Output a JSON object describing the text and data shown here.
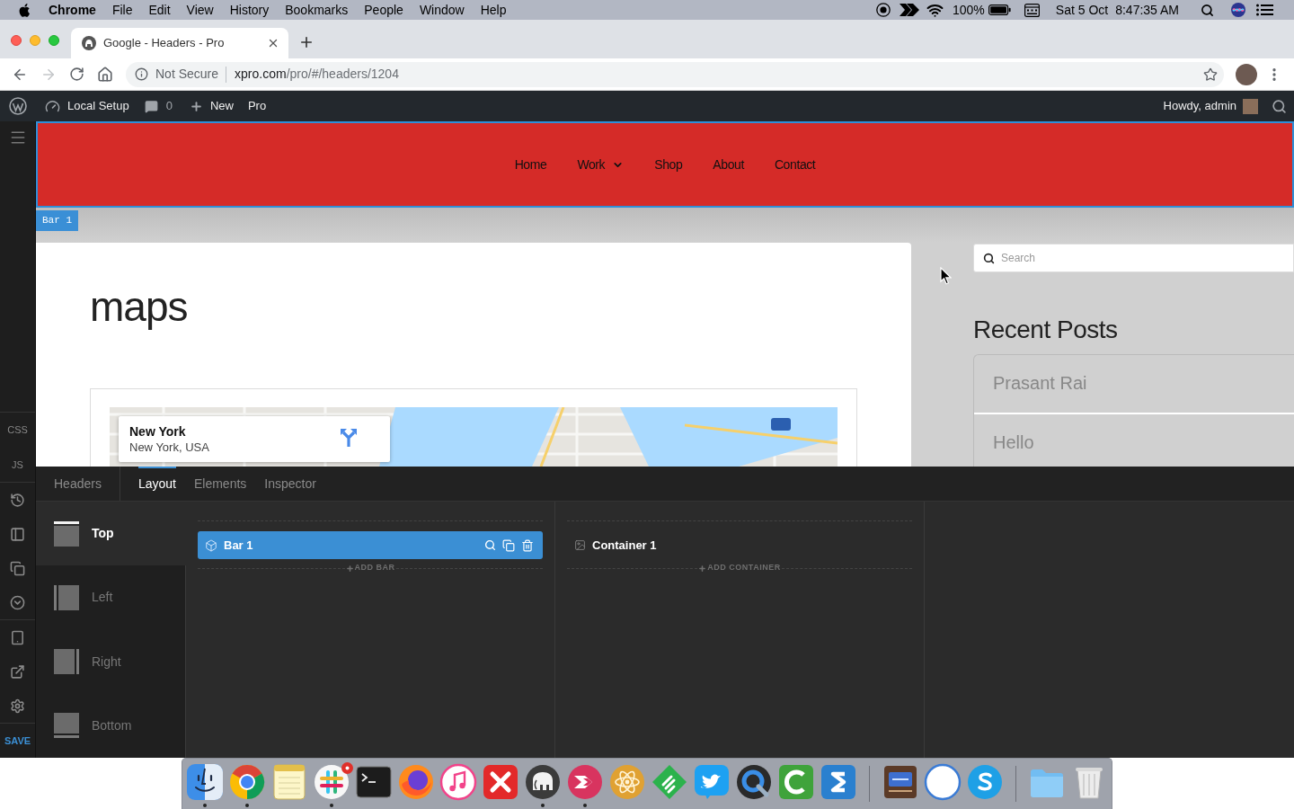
{
  "menu_bar": {
    "app": "Chrome",
    "menus": [
      "File",
      "Edit",
      "View",
      "History",
      "Bookmarks",
      "People",
      "Window",
      "Help"
    ],
    "battery": "100%",
    "date": "Sat 5 Oct",
    "time": "8:47:35 AM"
  },
  "browser": {
    "tab_title": "Google - Headers - Pro",
    "security": "Not Secure",
    "url_host": "xpro.com",
    "url_path": "/pro/#/headers/1204"
  },
  "admin_bar": {
    "site": "Local Setup",
    "comments": "0",
    "new": "New",
    "pro": "Pro",
    "greeting": "Howdy, admin"
  },
  "rail": {
    "css": "CSS",
    "js": "JS",
    "save": "SAVE"
  },
  "preview": {
    "nav": [
      {
        "label": "Home",
        "dropdown": false
      },
      {
        "label": "Work",
        "dropdown": true
      },
      {
        "label": "Shop",
        "dropdown": false
      },
      {
        "label": "About",
        "dropdown": false
      },
      {
        "label": "Contact",
        "dropdown": false
      }
    ],
    "bar_tag": "Bar 1",
    "page_title": "maps",
    "map_card": {
      "place": "New York",
      "address": "New York, USA"
    },
    "search": {
      "placeholder": "Search"
    },
    "recent_posts": {
      "title": "Recent Posts",
      "items": [
        "Prasant Rai",
        "Hello"
      ]
    }
  },
  "panel": {
    "back_tab": "Headers",
    "tabs": [
      {
        "label": "Layout",
        "selected": true
      },
      {
        "label": "Elements",
        "selected": false
      },
      {
        "label": "Inspector",
        "selected": false
      }
    ],
    "positions": [
      {
        "label": "Top",
        "selected": true
      },
      {
        "label": "Left",
        "selected": false
      },
      {
        "label": "Right",
        "selected": false
      },
      {
        "label": "Bottom",
        "selected": false
      }
    ],
    "bars": [
      {
        "label": "Bar 1",
        "selected": true
      }
    ],
    "add_bar": "ADD BAR",
    "containers": [
      {
        "label": "Container 1",
        "selected": false
      }
    ],
    "add_container": "ADD CONTAINER"
  },
  "dock": [
    {
      "running": true,
      "badge": false
    },
    {
      "running": true,
      "badge": false
    },
    {
      "running": false,
      "badge": false
    },
    {
      "running": true,
      "badge": true
    },
    {
      "running": false,
      "badge": false
    },
    {
      "running": false,
      "badge": false
    },
    {
      "running": false,
      "badge": false
    },
    {
      "running": false,
      "badge": false
    },
    {
      "running": true,
      "badge": false
    },
    {
      "running": true,
      "badge": false
    },
    {
      "running": false,
      "badge": false
    },
    {
      "running": false,
      "badge": false
    },
    {
      "running": false,
      "badge": false
    },
    {
      "running": false,
      "badge": false
    },
    {
      "running": false,
      "badge": false
    },
    {
      "running": false,
      "badge": false
    },
    {
      "running": false,
      "badge": false
    },
    {
      "running": false,
      "badge": false
    },
    {
      "running": false,
      "badge": false
    },
    {
      "running": false,
      "badge": false
    },
    {
      "running": false,
      "badge": false
    }
  ]
}
